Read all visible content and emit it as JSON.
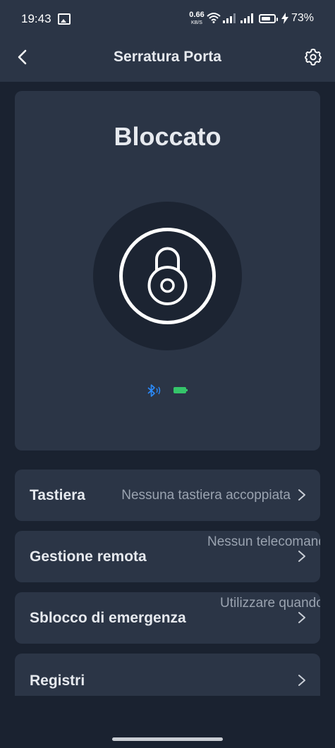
{
  "status_bar": {
    "time": "19:43",
    "net_speed_value": "0.66",
    "net_speed_unit": "KB/S",
    "battery_percent": "73%",
    "battery_level": 0.73
  },
  "appbar": {
    "title": "Serratura Porta",
    "back_icon": "chevron-left-icon",
    "settings_icon": "gear-icon"
  },
  "lock": {
    "state": "Bloccato",
    "icon": "padlock-icon",
    "bluetooth_icon": "bluetooth-icon",
    "battery_icon": "battery-icon",
    "bluetooth_color": "#2a8cff",
    "battery_color": "#35c56a"
  },
  "menu": [
    {
      "label": "Tastiera",
      "value": "Nessuna  tastiera accoppiata"
    },
    {
      "label": "Gestione  remota",
      "value": "Nessun telecomando accoppiato"
    },
    {
      "label": "Sblocco  di emergenza",
      "value": "Utilizzare quando non si"
    },
    {
      "label": "Registri",
      "value": ""
    }
  ],
  "colors": {
    "background": "#1a2230",
    "card": "#2b3546",
    "text": "#e6e9ee",
    "muted": "#9aa3b0"
  }
}
